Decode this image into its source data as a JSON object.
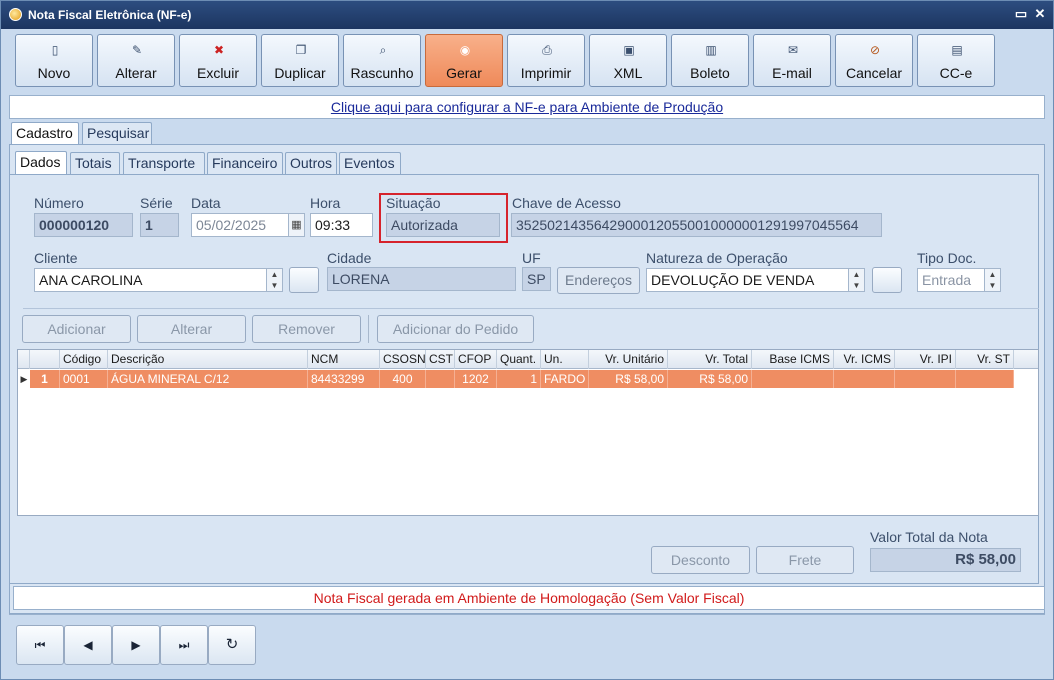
{
  "window": {
    "title": "Nota Fiscal Eletrônica (NF-e)"
  },
  "toolbar": [
    {
      "label": "Novo",
      "icon": "new-document-icon"
    },
    {
      "label": "Alterar",
      "icon": "edit-icon"
    },
    {
      "label": "Excluir",
      "icon": "delete-icon"
    },
    {
      "label": "Duplicar",
      "icon": "duplicate-icon"
    },
    {
      "label": "Rascunho",
      "icon": "draft-icon"
    },
    {
      "label": "Gerar",
      "icon": "generate-icon",
      "active": true
    },
    {
      "label": "Imprimir",
      "icon": "printer-icon"
    },
    {
      "label": "XML",
      "icon": "save-icon"
    },
    {
      "label": "Boleto",
      "icon": "barcode-icon"
    },
    {
      "label": "E-mail",
      "icon": "envelope-icon"
    },
    {
      "label": "Cancelar",
      "icon": "cancel-icon"
    },
    {
      "label": "CC-e",
      "icon": "correction-letter-icon"
    }
  ],
  "config_link": "Clique aqui para configurar a NF-e para Ambiente de Produção",
  "tabs_top": [
    "Cadastro",
    "Pesquisar"
  ],
  "tabs_inner": [
    "Dados",
    "Totais",
    "Transporte",
    "Financeiro",
    "Outros",
    "Eventos"
  ],
  "form": {
    "numero_label": "Número",
    "numero": "000000120",
    "serie_label": "Série",
    "serie": "1",
    "data_label": "Data",
    "data": "05/02/2025",
    "hora_label": "Hora",
    "hora": "09:33",
    "situacao_label": "Situação",
    "situacao": "Autorizada",
    "chave_label": "Chave de Acesso",
    "chave": "35250214356429000120550010000001291997045564",
    "cliente_label": "Cliente",
    "cliente": "ANA CAROLINA",
    "cidade_label": "Cidade",
    "cidade": "LORENA",
    "uf_label": "UF",
    "uf": "SP",
    "enderecos_label": "Endereços",
    "natureza_label": "Natureza de Operação",
    "natureza": "DEVOLUÇÃO DE VENDA",
    "tipo_label": "Tipo Doc.",
    "tipo": "Entrada"
  },
  "item_buttons": [
    "Adicionar",
    "Alterar",
    "Remover",
    "Adicionar do Pedido"
  ],
  "items_table": {
    "columns": [
      "Código",
      "Descrição",
      "NCM",
      "CSOSN",
      "CST",
      "CFOP",
      "Quant.",
      "Un.",
      "Vr. Unitário",
      "Vr. Total",
      "Base ICMS",
      "Vr. ICMS",
      "Vr. IPI",
      "Vr. ST"
    ],
    "rows": [
      {
        "num": "1",
        "codigo": "0001",
        "descricao": "ÁGUA MINERAL C/12",
        "ncm": "84433299",
        "csosn": "400",
        "cst": "",
        "cfop": "1202",
        "quant": "1",
        "un": "FARDO",
        "vr_unit": "R$ 58,00",
        "vr_total": "R$ 58,00",
        "base_icms": "",
        "vr_icms": "",
        "vr_ipi": "",
        "vr_st": ""
      }
    ]
  },
  "footer": {
    "desconto": "Desconto",
    "frete": "Frete",
    "valor_total_label": "Valor Total da Nota",
    "valor_total": "R$ 58,00"
  },
  "status_message": "Nota Fiscal gerada em Ambiente de Homologação (Sem Valor Fiscal)",
  "nav": [
    {
      "name": "first-record-icon",
      "glyph": "⏮"
    },
    {
      "name": "previous-record-icon",
      "glyph": "◀"
    },
    {
      "name": "next-record-icon",
      "glyph": "▶"
    },
    {
      "name": "last-record-icon",
      "glyph": "⏭"
    },
    {
      "name": "refresh-icon",
      "glyph": "↻"
    }
  ],
  "colors": {
    "accent_active": "#ef8a5a",
    "titlebar": "#1c3560",
    "warning": "#d11a1a",
    "highlight_box": "#d6232c"
  }
}
